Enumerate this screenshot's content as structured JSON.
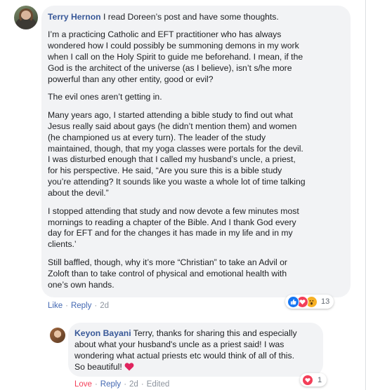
{
  "comment": {
    "author": "Terry Hernon",
    "paragraphs": [
      [
        " I read Doreen’s post and have some thoughts."
      ],
      [
        "I’m a practicing Catholic and EFT practitioner who has always",
        "wondered how I could possibly be summoning demons in my work",
        "when I call on the Holy Spirit to guide me beforehand. I mean, if the",
        "God is the architect of the universe (as I believe), isn’t s/he more",
        "powerful than any other entity, good or evil?"
      ],
      [
        "The evil ones aren’t getting in."
      ],
      [
        "Many years ago, I started attending a bible study to find out what",
        "Jesus really said about gays (he didn’t mention them) and women",
        "(he championed us at every turn). The leader of the study",
        "maintained, though, that my yoga classes were portals for the devil.",
        "I was disturbed enough that I called my husband’s uncle, a priest,",
        "for his perspective. He said, “Are you sure this is a bible study",
        "you’re attending? It sounds like you waste a whole lot of time talking",
        "about the devil.”"
      ],
      [
        "I stopped attending that study and now devote a few minutes most",
        "mornings to reading a chapter of the Bible. And I thank God every",
        "day for EFT and for the changes it has made in my life and in my",
        "clients.’"
      ],
      [
        "Still baffled, though, why it’s more “Christian” to take an Advil or",
        "Zoloft than to take control of physical and emotional health with",
        "one’s own hands."
      ]
    ],
    "actions": {
      "like": "Like",
      "sep": "·",
      "reply": "Reply",
      "time": "2d"
    },
    "reactions": {
      "icons": [
        "like-icon",
        "love-icon",
        "wow-icon"
      ],
      "count": "13"
    }
  },
  "reply": {
    "author": "Keyon Bayani",
    "lines": [
      " Terry, thanks for sharing this and especially",
      "about what your husband's uncle as a priest said! I was",
      "wondering what actual priests etc would think of all of this.",
      "So beautiful! "
    ],
    "actions": {
      "love": "Love",
      "sep": "·",
      "reply": "Reply",
      "time": "2d",
      "edited": "Edited"
    },
    "reactions": {
      "icons": [
        "love-icon"
      ],
      "count": "1"
    }
  },
  "colors": {
    "bubble": "#f2f3f5",
    "author": "#385898",
    "link": "#4267b2",
    "love": "#f33e58",
    "like": "#1877f2",
    "wow": "#f7b125",
    "meta": "#8d949e"
  }
}
